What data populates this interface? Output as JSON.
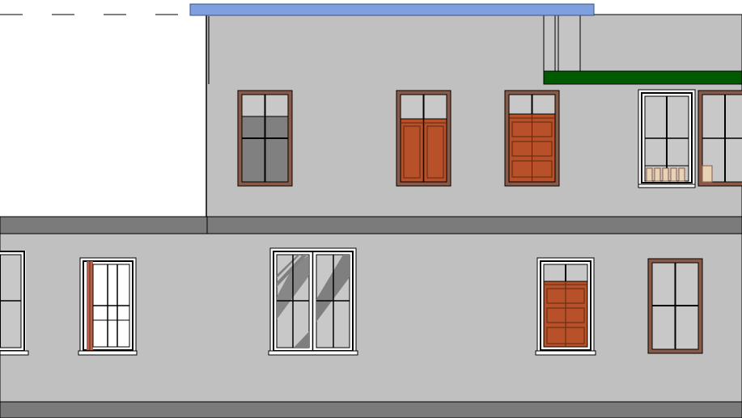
{
  "drawing": {
    "view_type": "elevation",
    "colors": {
      "wall": "#c0c0c0",
      "wall_shadow": "#b4b4b4",
      "roof_edge": "#809fdf",
      "ledge": "#7b7b7b",
      "green_roof": "#005a00",
      "frame_brown": "#8a5a48",
      "glass_grey": "#808080",
      "door_wood": "#b8502a",
      "outline": "#000000",
      "white": "#ffffff"
    },
    "window_styles": [
      "brown-frame-grey-fill",
      "brown-frame-wood-doors",
      "brown-frame-wood-panels",
      "white-frame-railing",
      "white-frame-brown-jamb",
      "white-frame-diagonal-glare",
      "white-frame-wood-panels",
      "brown-frame-plain"
    ]
  }
}
